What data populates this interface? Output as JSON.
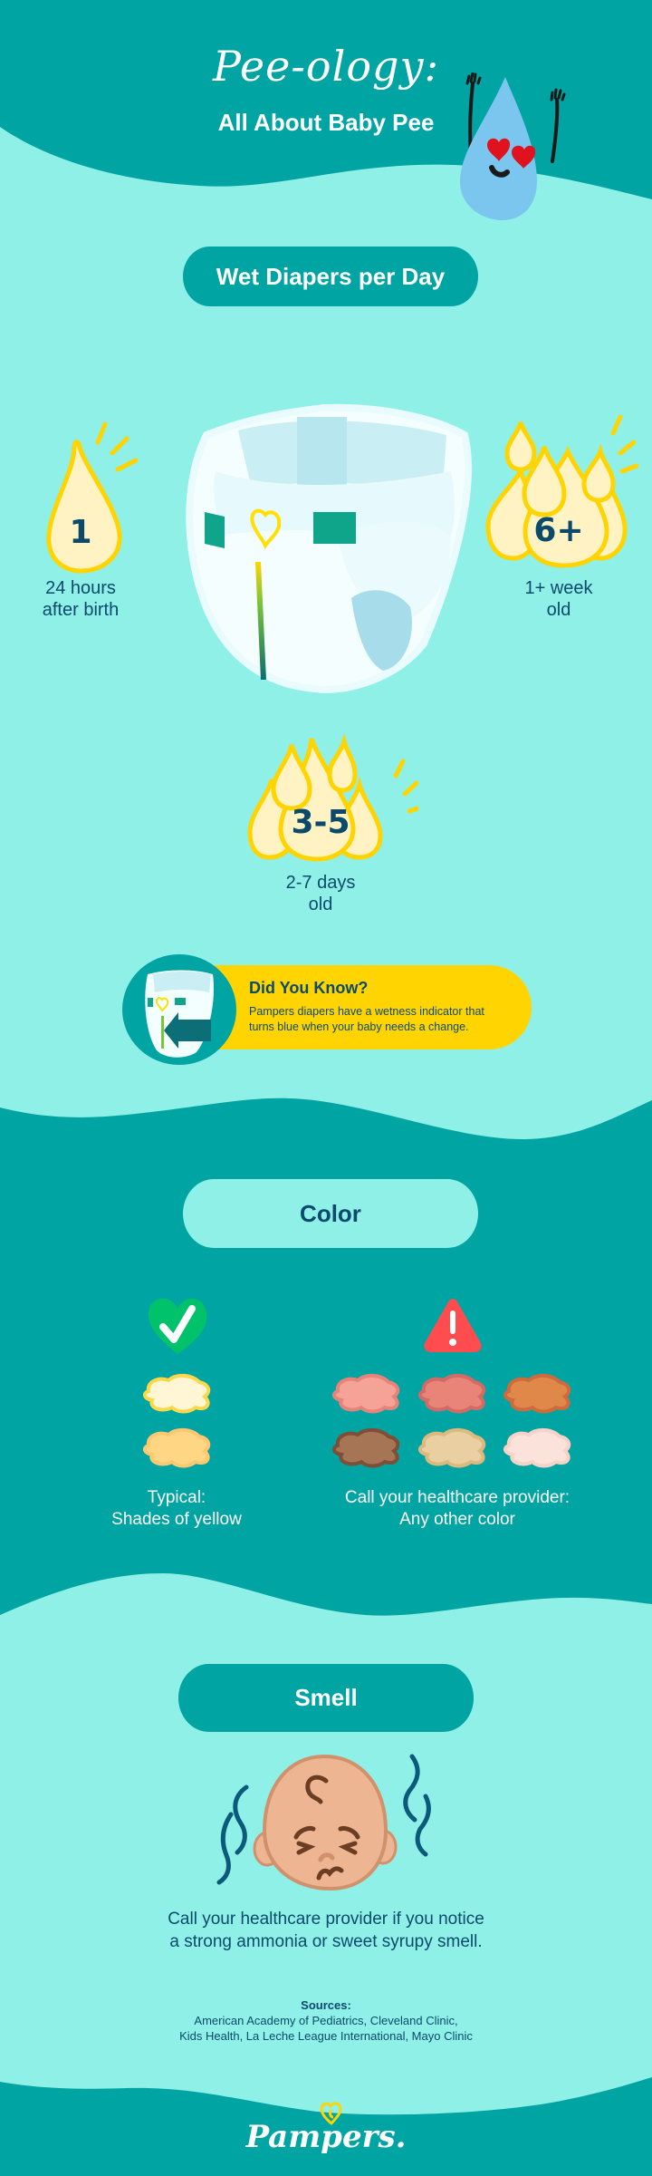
{
  "colors": {
    "dark_teal": "#00A4A2",
    "light_teal": "#8FF0E8",
    "navy_text": "#0B4A6B",
    "yellow": "#FFD400",
    "drop_fill": "#FFF3C4"
  },
  "header": {
    "title": "Pee-ology:",
    "subtitle": "All About Baby Pee",
    "mascot_icon": "happy-water-drop-icon"
  },
  "wet_diapers": {
    "heading": "Wet Diapers per Day",
    "product_image": "diaper-illustration",
    "stages": [
      {
        "count": "1",
        "label_line1": "24 hours",
        "label_line2": "after birth",
        "icon": "single-drop-icon"
      },
      {
        "count": "6+",
        "label_line1": "1+ week",
        "label_line2": "old",
        "icon": "six-drops-icon"
      },
      {
        "count": "3-5",
        "label_line1": "2-7 days",
        "label_line2": "old",
        "icon": "five-drops-icon"
      }
    ],
    "did_you_know": {
      "title": "Did You Know?",
      "body_line1": "Pampers diapers have a wetness indicator that",
      "body_line2": "turns blue when your baby needs a change.",
      "icon": "wetness-indicator-diaper-icon"
    }
  },
  "color": {
    "heading": "Color",
    "typical": {
      "icon": "check-heart-icon",
      "label_line1": "Typical:",
      "label_line2": "Shades of yellow",
      "swatches": [
        "#FFF6D6",
        "#FFD784"
      ],
      "swatch_borders": [
        "#FFD84A",
        "#FFC870"
      ]
    },
    "warning": {
      "icon": "warning-triangle-icon",
      "label_line1": "Call your healthcare provider:",
      "label_line2": "Any other color",
      "swatches": [
        "#F4A396",
        "#E88478",
        "#E0884A",
        "#A57556",
        "#E9CFA2",
        "#FBE2DA"
      ],
      "swatch_borders": [
        "#E8837A",
        "#D46A66",
        "#D06A3C",
        "#7E4E37",
        "#DDB97E",
        "#F7D2C6"
      ]
    }
  },
  "smell": {
    "heading": "Smell",
    "illustration": "baby-face-smell-icon",
    "text_line1": "Call your healthcare provider if you notice",
    "text_line2": "a strong ammonia or sweet syrupy smell."
  },
  "sources": {
    "heading": "Sources:",
    "line1": "American Academy of Pediatrics, Cleveland Clinic,",
    "line2": "Kids Health, La Leche League International, Mayo Clinic"
  },
  "footer": {
    "brand": "Pampers.",
    "logo_icon": "pampers-heart-logo-icon"
  }
}
